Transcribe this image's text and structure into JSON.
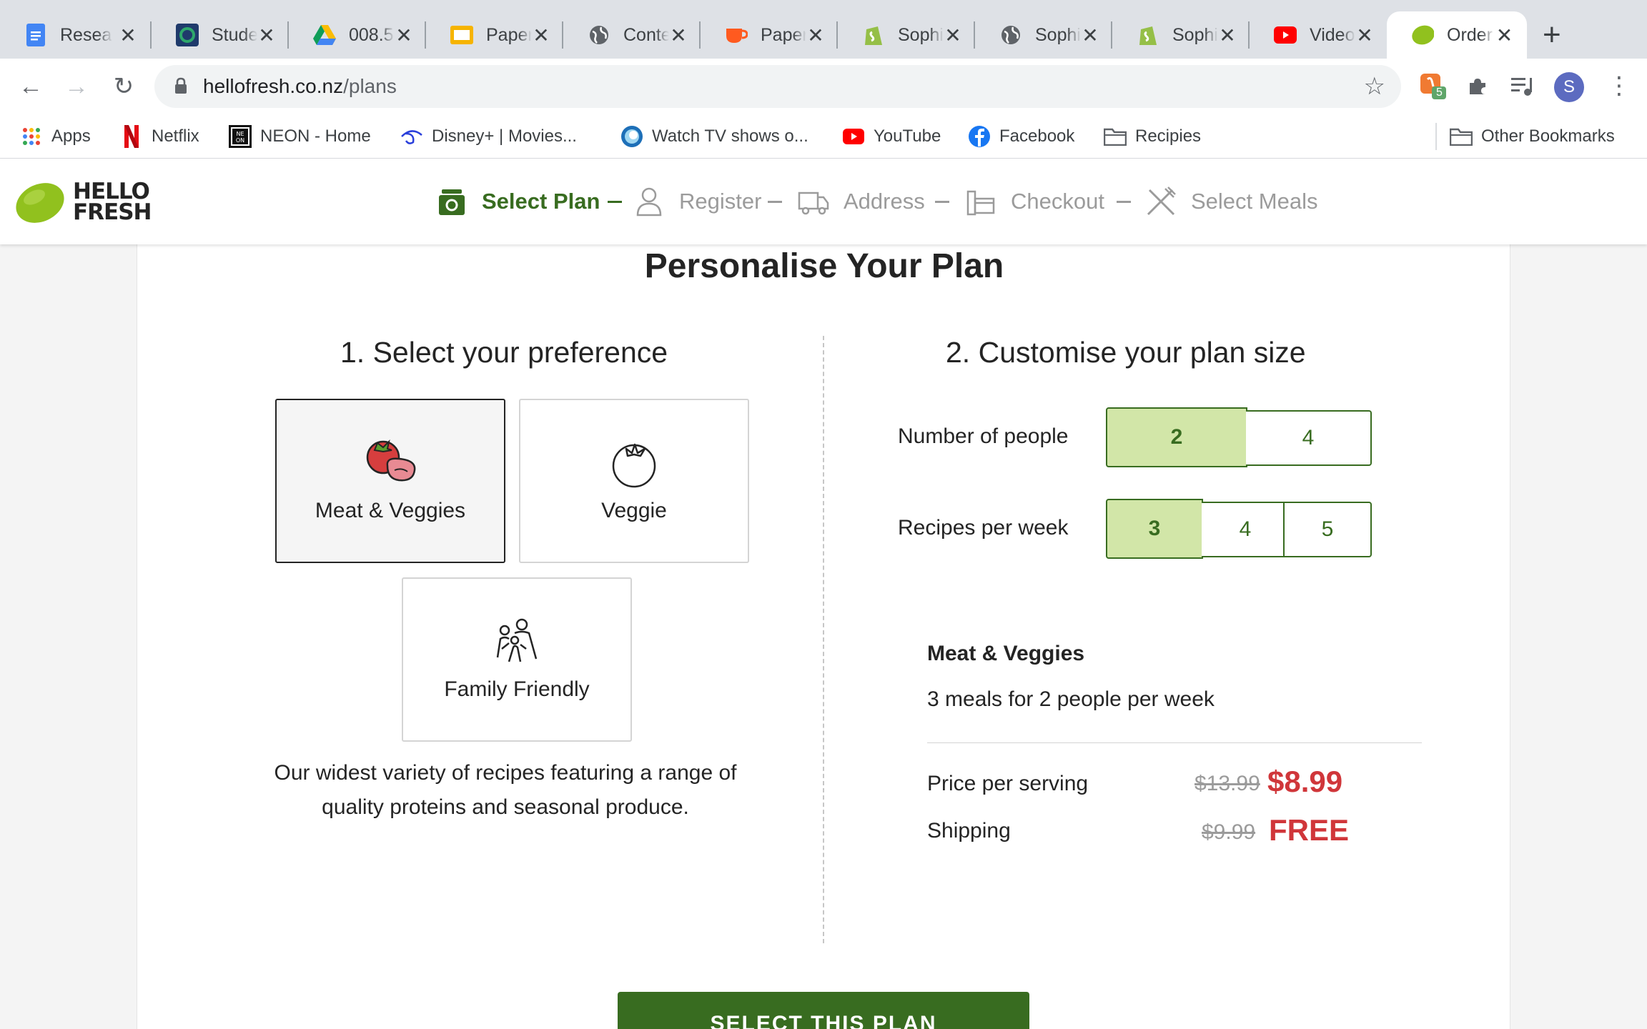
{
  "browser": {
    "tabs": [
      {
        "title": "Research",
        "icon": "google-docs-icon"
      },
      {
        "title": "Student",
        "icon": "student-portal-icon"
      },
      {
        "title": "008.5",
        "icon": "google-drive-icon"
      },
      {
        "title": "Paper",
        "icon": "paper-doc-icon"
      },
      {
        "title": "Content",
        "icon": "globe-icon"
      },
      {
        "title": "Paper",
        "icon": "coffee-cup-icon"
      },
      {
        "title": "Sophie",
        "icon": "shopify-icon"
      },
      {
        "title": "Sophie",
        "icon": "globe-icon"
      },
      {
        "title": "Sophie",
        "icon": "shopify-icon"
      },
      {
        "title": "Video",
        "icon": "youtube-icon"
      },
      {
        "title": "Order",
        "icon": "hellofresh-lime-icon",
        "active": true
      }
    ],
    "url_host": "hellofresh.co.nz",
    "url_path": "/plans",
    "extension_badge": "5",
    "profile_initial": "S",
    "bookmarks": [
      {
        "label": "Apps",
        "icon": "apps-grid-icon"
      },
      {
        "label": "Netflix",
        "icon": "netflix-icon"
      },
      {
        "label": "NEON - Home",
        "icon": "neon-icon"
      },
      {
        "label": "Disney+ | Movies...",
        "icon": "disney-plus-icon"
      },
      {
        "label": "Watch TV shows o...",
        "icon": "tvnz-icon"
      },
      {
        "label": "YouTube",
        "icon": "youtube-icon"
      },
      {
        "label": "Facebook",
        "icon": "facebook-icon"
      },
      {
        "label": "Recipies",
        "icon": "folder-icon"
      }
    ],
    "other_bookmarks": "Other Bookmarks"
  },
  "site": {
    "logo_line1": "HELLO",
    "logo_line2": "FRESH",
    "steps": [
      {
        "label": "Select Plan",
        "icon": "plan-box-icon",
        "active": true
      },
      {
        "label": "Register",
        "icon": "user-icon"
      },
      {
        "label": "Address",
        "icon": "delivery-truck-icon"
      },
      {
        "label": "Checkout",
        "icon": "card-icon"
      },
      {
        "label": "Select Meals",
        "icon": "fork-knife-icon"
      }
    ]
  },
  "plan": {
    "page_title": "Personalise Your Plan",
    "preference_title": "1. Select your preference",
    "preferences": [
      {
        "label": "Meat & Veggies",
        "icon": "meat-veggies-icon",
        "selected": true
      },
      {
        "label": "Veggie",
        "icon": "tomato-icon"
      },
      {
        "label": "Family Friendly",
        "icon": "family-icon"
      }
    ],
    "preference_description": "Our widest variety of recipes featuring a range of quality proteins and seasonal produce.",
    "size_title": "2. Customise your plan size",
    "people_label": "Number of people",
    "people_options": [
      "2",
      "4"
    ],
    "people_selected": "2",
    "recipes_label": "Recipes per week",
    "recipes_options": [
      "3",
      "4",
      "5"
    ],
    "recipes_selected": "3",
    "summary_title": "Meat & Veggies",
    "summary_subtitle": "3 meals for 2 people per week",
    "price_label": "Price per serving",
    "price_old": "$13.99",
    "price_new": "$8.99",
    "shipping_label": "Shipping",
    "shipping_old": "$9.99",
    "shipping_new": "FREE",
    "cta_label": "SELECT THIS PLAN"
  },
  "colors": {
    "brand_green": "#386c20",
    "selected_fill": "#d2e6a8",
    "price_red": "#d0363a",
    "lime": "#91c11e"
  }
}
